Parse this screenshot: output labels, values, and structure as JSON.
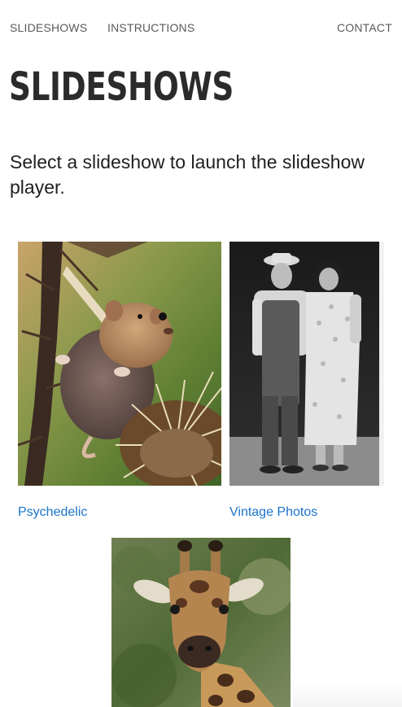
{
  "nav": {
    "items": [
      {
        "label": "SLIDESHOWS"
      },
      {
        "label": "INSTRUCTIONS"
      },
      {
        "label": "CONTACT"
      }
    ]
  },
  "page": {
    "title": "SLIDESHOWS",
    "intro": "Select a slideshow to launch the slideshow player."
  },
  "slideshows": [
    {
      "label": "Psychedelic",
      "image": "harvest-mouse-on-thistle"
    },
    {
      "label": "Vintage Photos",
      "image": "vintage-couple-portrait"
    },
    {
      "label": "",
      "image": "giraffe-portrait"
    }
  ],
  "colors": {
    "link": "#1a73c9",
    "title": "#2b2b2b",
    "nav": "#5a5a5a"
  }
}
